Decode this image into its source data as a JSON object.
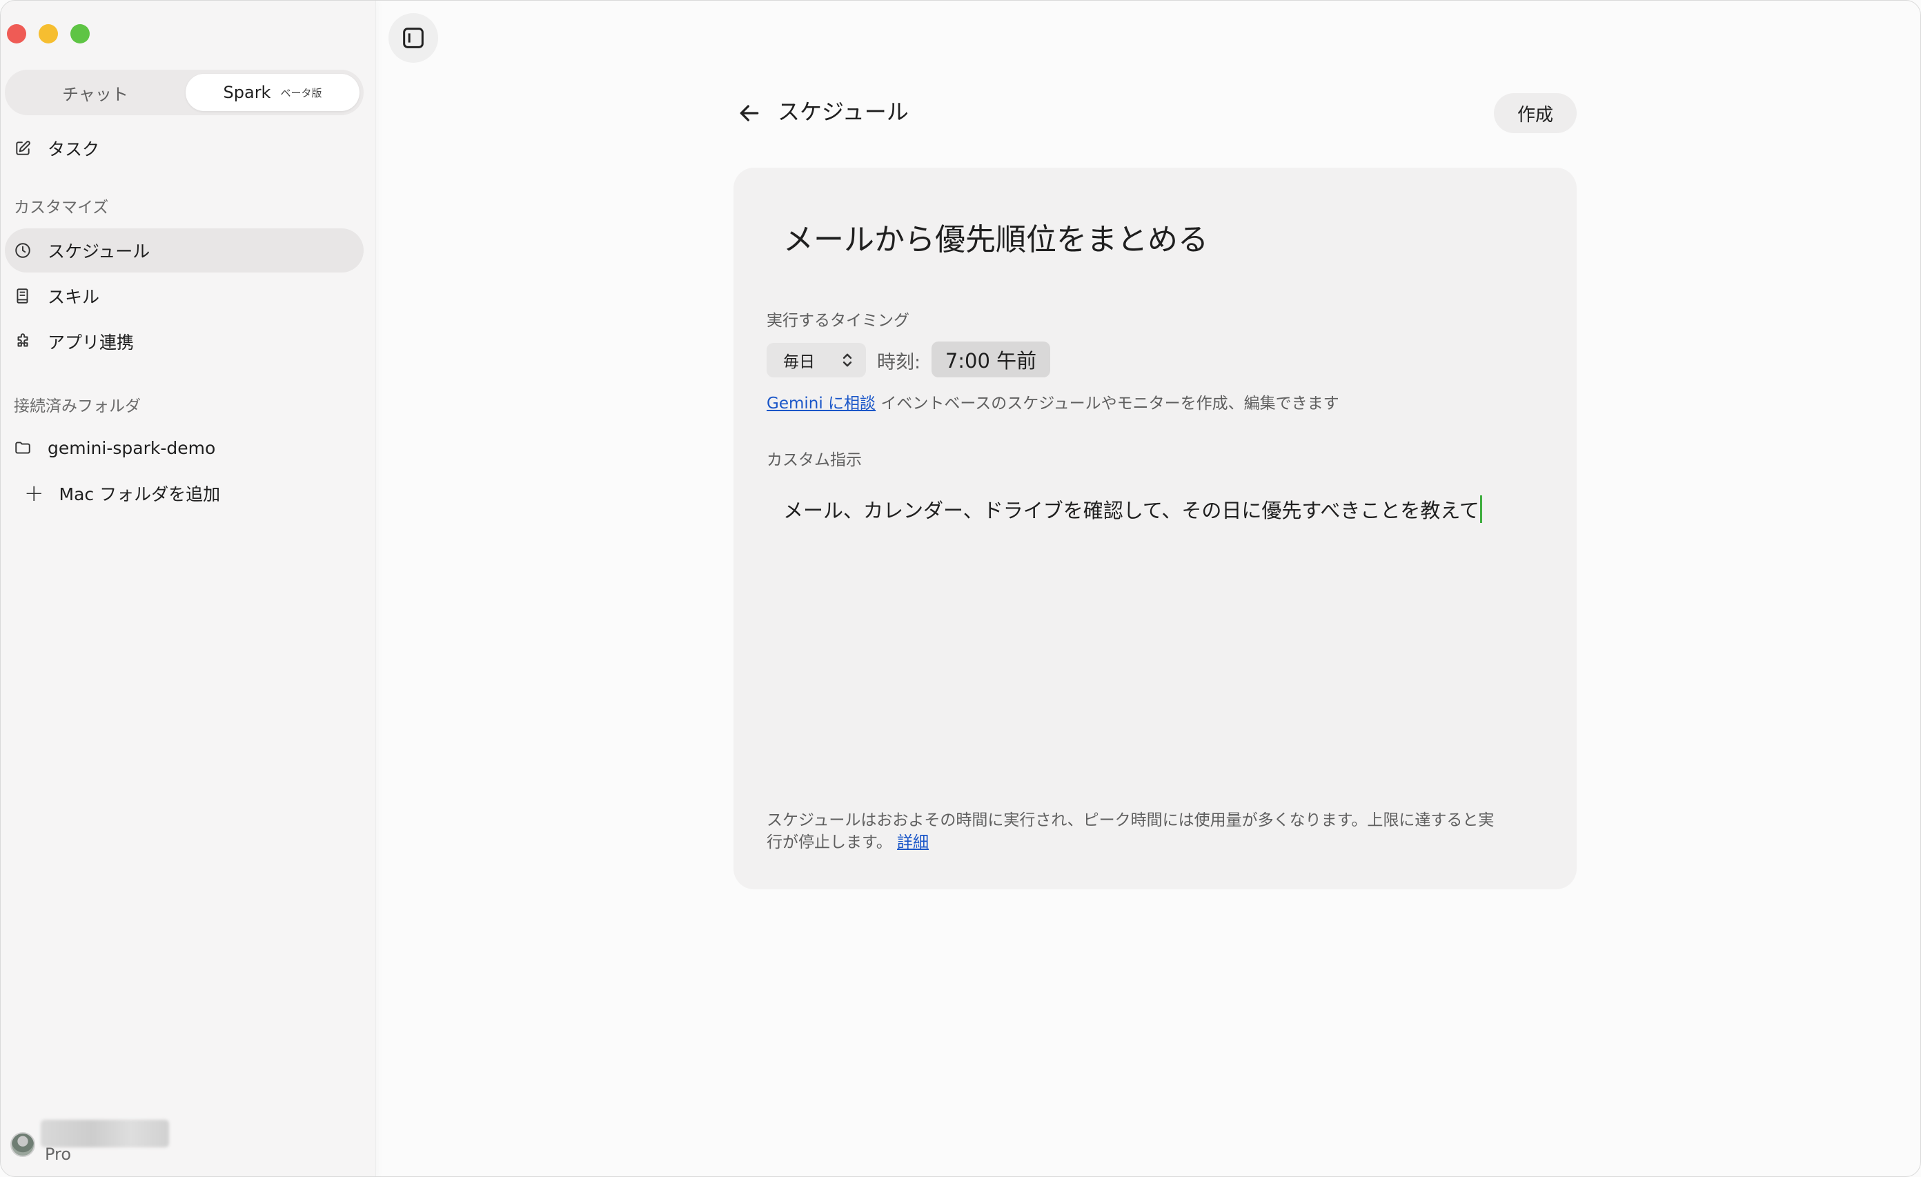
{
  "sidebar": {
    "tabs": {
      "chat": "チャット",
      "spark": "Spark",
      "spark_badge": "ベータ版"
    },
    "task": "タスク",
    "customize_label": "カスタマイズ",
    "schedule": "スケジュール",
    "skills": "スキル",
    "app_integration": "アプリ連携",
    "folders_label": "接続済みフォルダ",
    "folder_name": "gemini-spark-demo",
    "add_folder": "Mac フォルダを追加",
    "plan": "Pro"
  },
  "header": {
    "title": "スケジュール",
    "create_label": "作成"
  },
  "card": {
    "title": "メールから優先順位をまとめる",
    "timing_label": "実行するタイミング",
    "frequency": "毎日",
    "time_label": "時刻:",
    "time_value": "7:00 午前",
    "hint_link": "Gemini に相談",
    "hint_text": " イベントベースのスケジュールやモニターを作成、編集できます",
    "instruction_label": "カスタム指示",
    "instruction_text": "メール、カレンダー、ドライブを確認して、その日に優先すべきことを教えて",
    "note_line1": "スケジュールはおおよその時間に実行され、ピーク時間には使用量が多くなります。上限に達すると実",
    "note_line2": "行が停止します。",
    "note_link": "詳細"
  },
  "colors": {
    "accent_link": "#1a56c8",
    "caret": "#3fae3f"
  }
}
